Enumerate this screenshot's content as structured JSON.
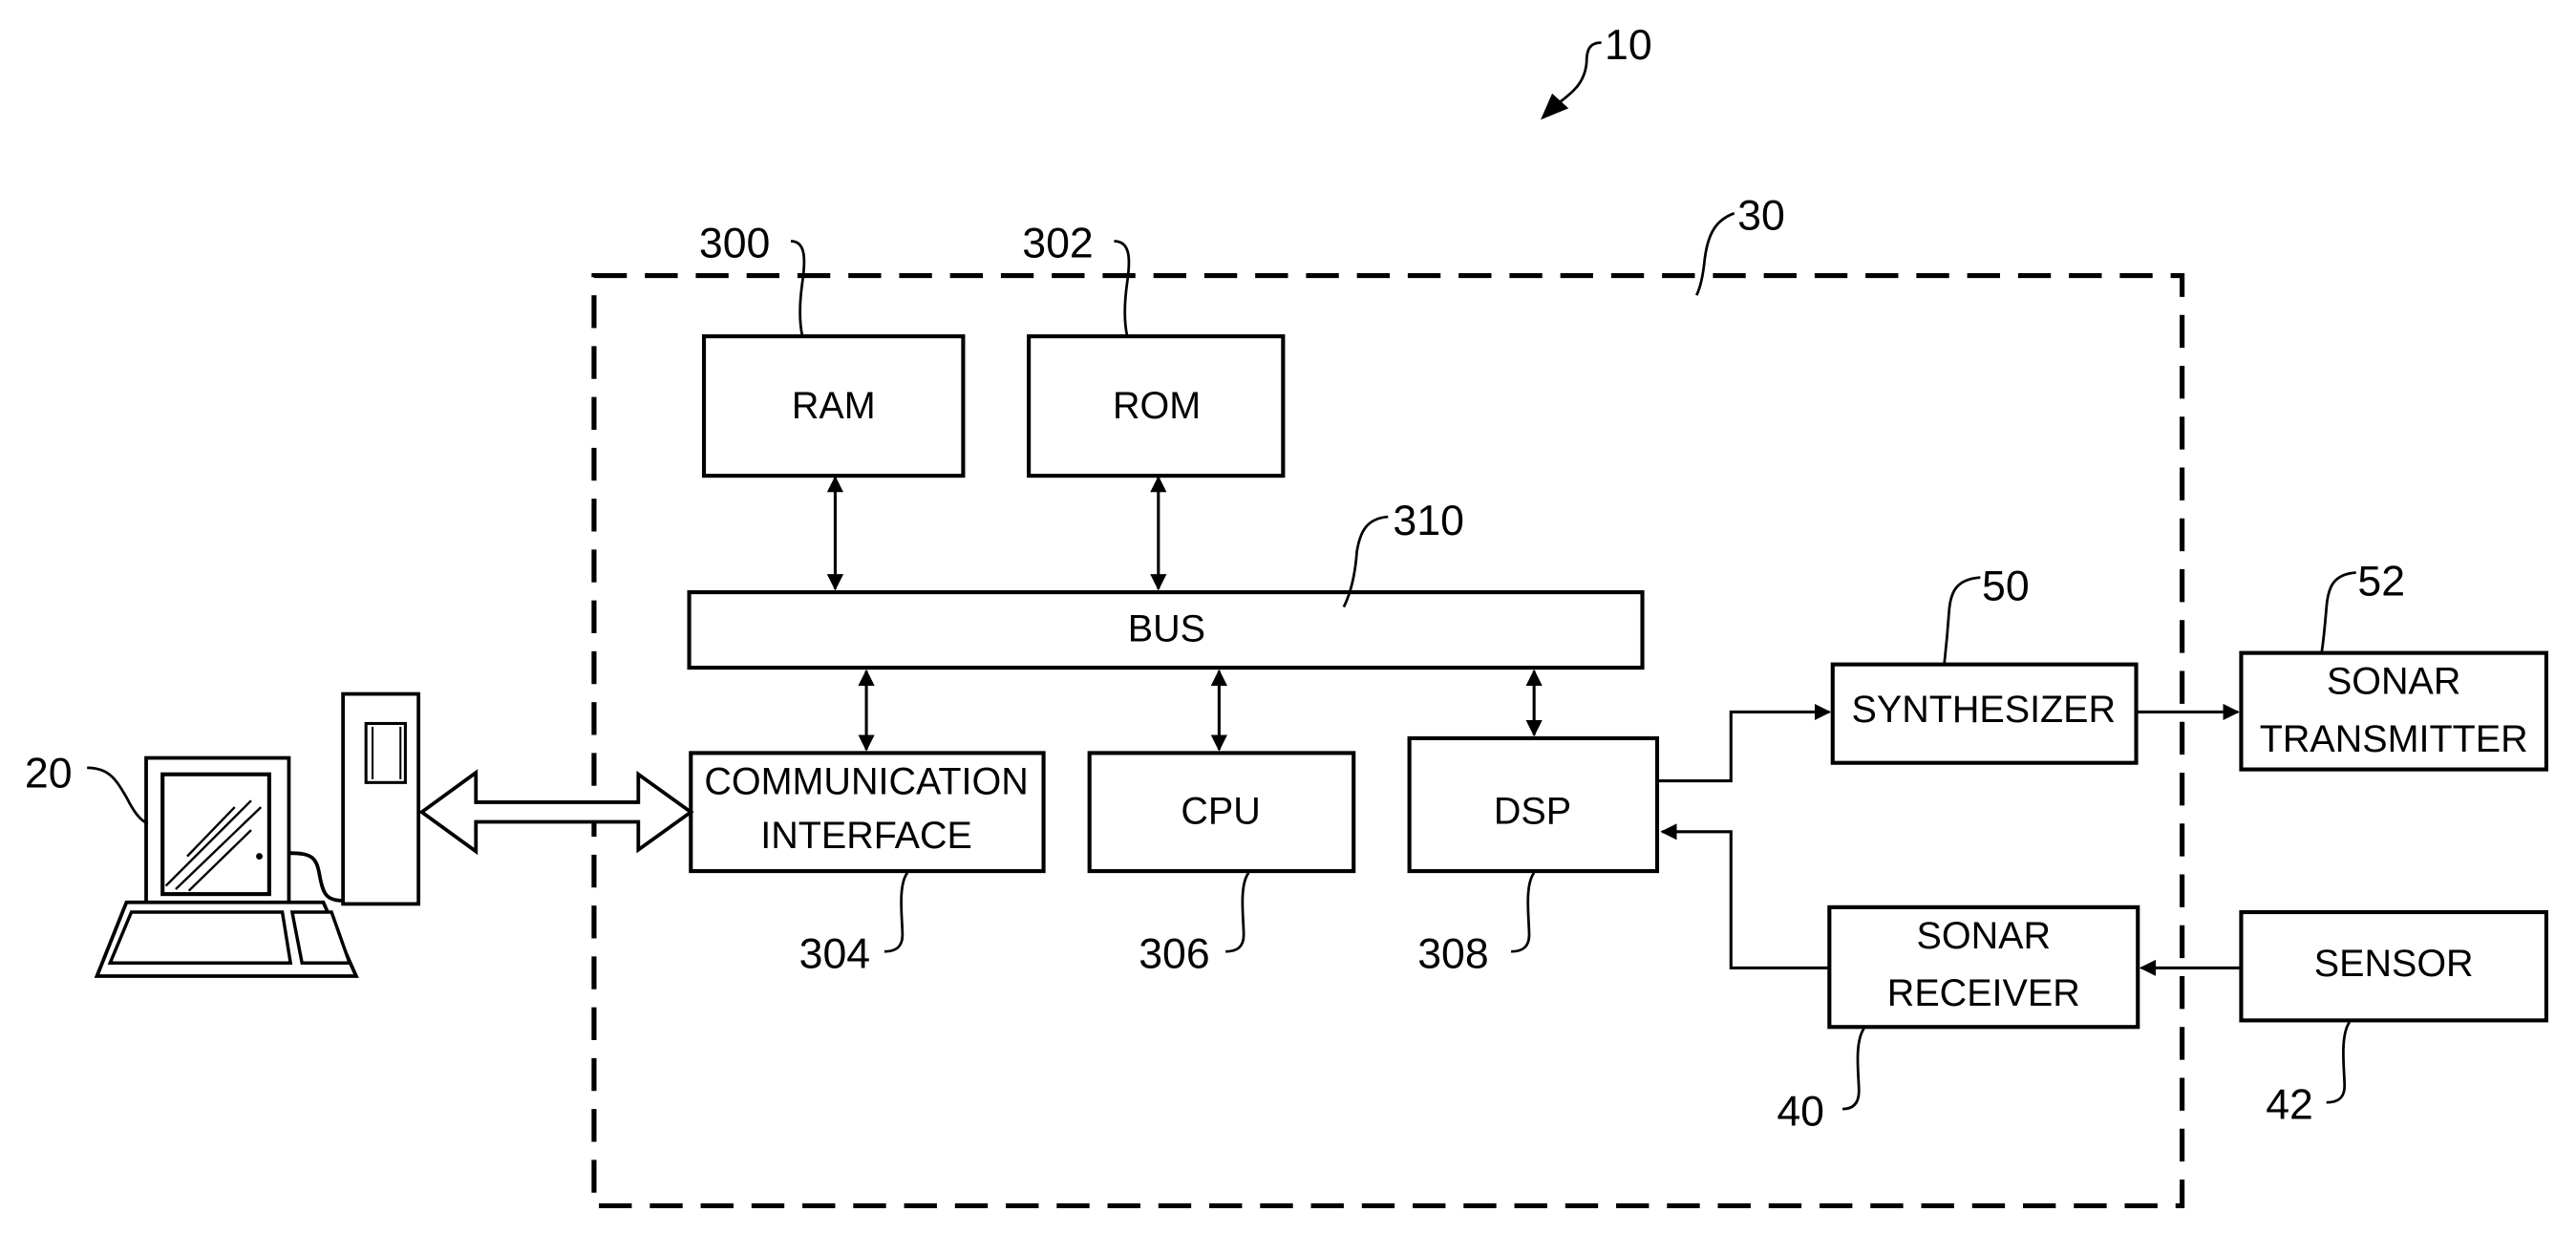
{
  "figure": {
    "reference": "10",
    "controller_ref": "30"
  },
  "blocks": {
    "ram": {
      "label": "RAM",
      "ref": "300"
    },
    "rom": {
      "label": "ROM",
      "ref": "302"
    },
    "bus": {
      "label": "BUS",
      "ref": "310"
    },
    "comm": {
      "label_line1": "COMMUNICATION",
      "label_line2": "INTERFACE",
      "ref": "304"
    },
    "cpu": {
      "label": "CPU",
      "ref": "306"
    },
    "dsp": {
      "label": "DSP",
      "ref": "308"
    },
    "synth": {
      "label": "SYNTHESIZER",
      "ref": "50"
    },
    "transmitter": {
      "label_line1": "SONAR",
      "label_line2": "TRANSMITTER",
      "ref": "52"
    },
    "receiver": {
      "label_line1": "SONAR",
      "label_line2": "RECEIVER",
      "ref": "40"
    },
    "sensor": {
      "label": "SENSOR",
      "ref": "42"
    }
  },
  "computer": {
    "ref": "20"
  }
}
